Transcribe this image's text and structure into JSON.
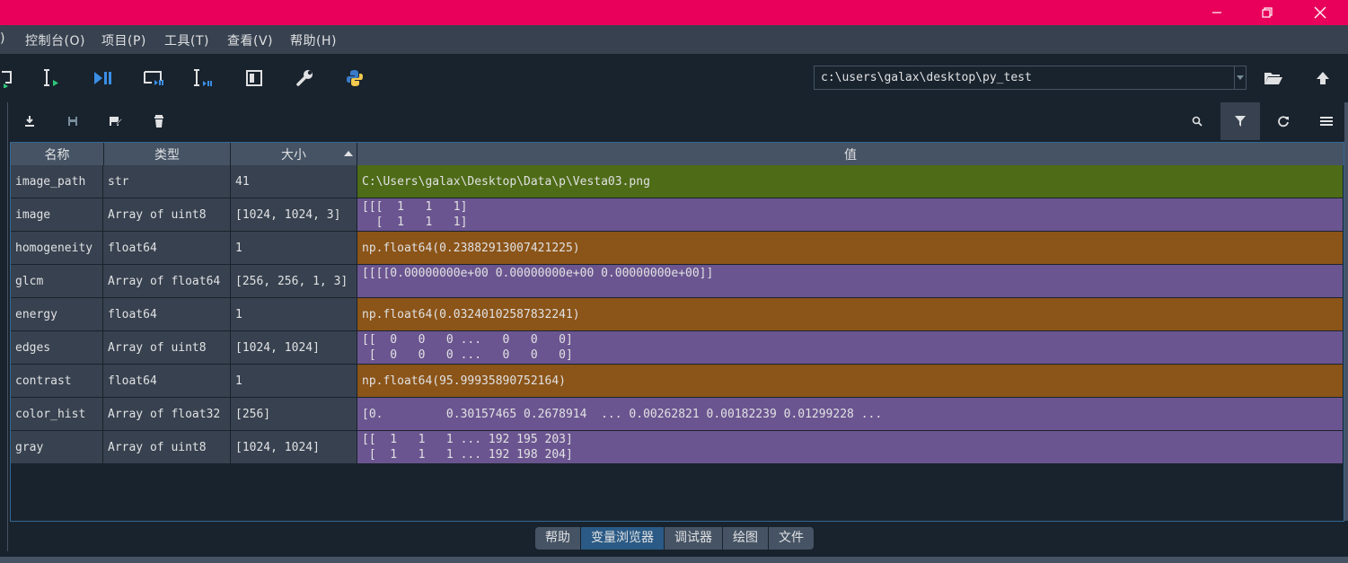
{
  "window": {
    "controls": {
      "minimize": "—",
      "maximize": "❐",
      "close": "✕"
    }
  },
  "menubar": {
    "items": [
      {
        "label": ")"
      },
      {
        "label": "控制台(O)"
      },
      {
        "label": "项目(P)"
      },
      {
        "label": "工具(T)"
      },
      {
        "label": "查看(V)"
      },
      {
        "label": "帮助(H)"
      }
    ]
  },
  "toolbar": {
    "path_value": "c:\\users\\galax\\desktop\\py_test",
    "icons": [
      "run-cell-advance-icon",
      "run-selection-icon",
      "debug-continue-icon",
      "debug-cell-icon",
      "debug-selection-icon",
      "maximize-pane-icon",
      "wrench-icon",
      "python-icon",
      "open-folder-icon",
      "parent-directory-icon"
    ]
  },
  "variable_explorer": {
    "toolbar_icons": [
      "import-data-icon",
      "save-data-icon",
      "save-as-icon",
      "remove-all-icon",
      "search-icon",
      "filter-icon",
      "refresh-icon",
      "options-menu-icon"
    ],
    "columns": {
      "name": "名称",
      "type": "类型",
      "size": "大小",
      "value": "值"
    },
    "rows": [
      {
        "name": "image_path",
        "type": "str",
        "size": "41",
        "value": "C:\\Users\\galax\\Desktop\\Data\\p\\Vesta03.png",
        "color": "green",
        "lines": 1
      },
      {
        "name": "image",
        "type": "Array of uint8",
        "size": "[1024, 1024, 3]",
        "value": "[[[  1   1   1]\n  [  1   1   1]",
        "color": "purple",
        "lines": 2
      },
      {
        "name": "homogeneity",
        "type": "float64",
        "size": "1",
        "value": "np.float64(0.23882913007421225)",
        "color": "orange",
        "lines": 1
      },
      {
        "name": "glcm",
        "type": "Array of float64",
        "size": "[256, 256, 1, 3]",
        "value": "[[[[0.00000000e+00 0.00000000e+00 0.00000000e+00]]",
        "color": "purple",
        "lines": 2
      },
      {
        "name": "energy",
        "type": "float64",
        "size": "1",
        "value": "np.float64(0.03240102587832241)",
        "color": "orange",
        "lines": 1
      },
      {
        "name": "edges",
        "type": "Array of uint8",
        "size": "[1024, 1024]",
        "value": "[[  0   0   0 ...   0   0   0]\n [  0   0   0 ...   0   0   0]",
        "color": "purple",
        "lines": 2
      },
      {
        "name": "contrast",
        "type": "float64",
        "size": "1",
        "value": "np.float64(95.99935890752164)",
        "color": "orange",
        "lines": 1
      },
      {
        "name": "color_hist",
        "type": "Array of float32",
        "size": "[256]",
        "value": "[0.         0.30157465 0.2678914  ... 0.00262821 0.00182239 0.01299228 ...",
        "color": "purple",
        "lines": 1
      },
      {
        "name": "gray",
        "type": "Array of uint8",
        "size": "[1024, 1024]",
        "value": "[[  1   1   1 ... 192 195 203]\n [  1   1   1 ... 192 198 204]",
        "color": "purple",
        "lines": 2
      }
    ]
  },
  "bottom_tabs": [
    {
      "label": "帮助",
      "active": false
    },
    {
      "label": "变量浏览器",
      "active": true
    },
    {
      "label": "调试器",
      "active": false
    },
    {
      "label": "绘图",
      "active": false
    },
    {
      "label": "文件",
      "active": false
    }
  ]
}
